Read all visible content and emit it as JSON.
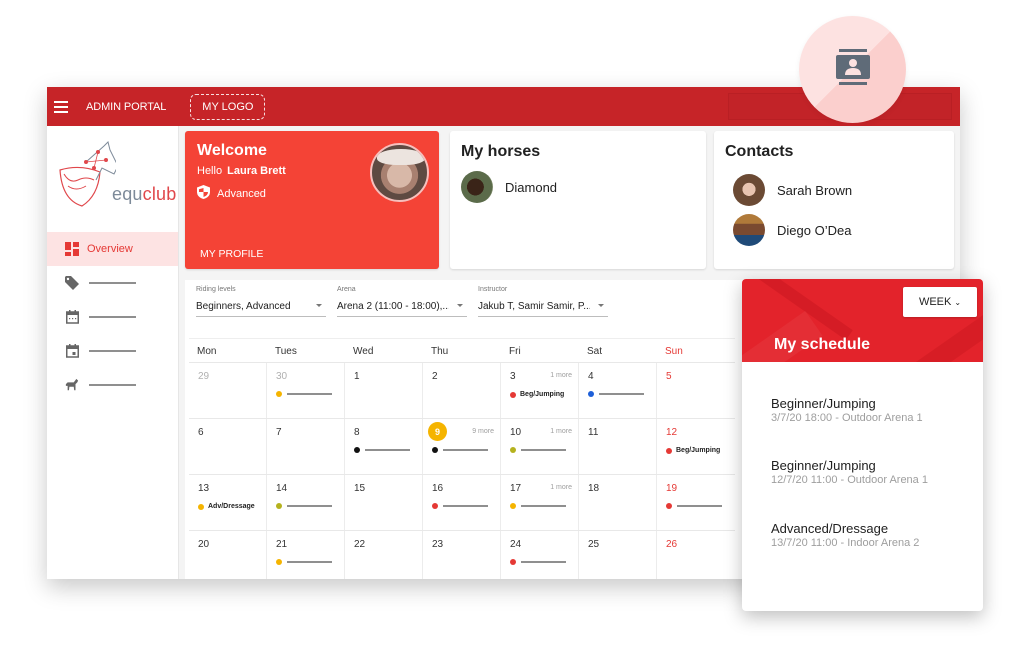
{
  "topbar": {
    "menu_icon": "hamburger-icon",
    "title": "ADMIN PORTAL",
    "logo_placeholder": "MY LOGO"
  },
  "floating_button": {
    "icon": "contact-card-icon"
  },
  "sidebar": {
    "brand": {
      "part1": "equ",
      "part2": "club"
    },
    "items": [
      {
        "icon": "dashboard-icon",
        "label": "Overview",
        "active": true
      },
      {
        "icon": "tag-icon",
        "label": ""
      },
      {
        "icon": "calendar-icon",
        "label": ""
      },
      {
        "icon": "calendar-event-icon",
        "label": ""
      },
      {
        "icon": "horse-icon",
        "label": ""
      }
    ]
  },
  "welcome": {
    "title": "Welcome",
    "hello": "Hello",
    "name": "Laura Brett",
    "level": "Advanced",
    "profile_link": "MY PROFILE"
  },
  "horses": {
    "title": "My horses",
    "items": [
      {
        "name": "Diamond"
      }
    ]
  },
  "contacts": {
    "title": "Contacts",
    "items": [
      {
        "name": "Sarah Brown"
      },
      {
        "name": "Diego O’Dea"
      }
    ]
  },
  "filters": [
    {
      "label": "Riding levels",
      "value": "Beginners, Advanced"
    },
    {
      "label": "Arena",
      "value": "Arena 2 (11:00 - 18:00),..."
    },
    {
      "label": "Instructor",
      "value": "Jakub T, Samir Samir, P..."
    }
  ],
  "calendar": {
    "weekdays": [
      "Mon",
      "Tues",
      "Wed",
      "Thu",
      "Fri",
      "Sat",
      "Sun"
    ],
    "weeks": [
      [
        {
          "day": "29",
          "muted": true
        },
        {
          "day": "30",
          "muted": true,
          "event": {
            "color": "#f5b400"
          }
        },
        {
          "day": "1"
        },
        {
          "day": "2"
        },
        {
          "day": "3",
          "more": "1 more",
          "event": {
            "color": "#e53935",
            "label": "Beg/Jumping"
          }
        },
        {
          "day": "4",
          "event": {
            "color": "#1e5fd8"
          }
        },
        {
          "day": "5",
          "sunday": true
        }
      ],
      [
        {
          "day": "6"
        },
        {
          "day": "7"
        },
        {
          "day": "8",
          "event": {
            "color": "#111111"
          }
        },
        {
          "day": "9",
          "today": true,
          "more": "9 more",
          "event": {
            "color": "#111111"
          }
        },
        {
          "day": "10",
          "more": "1 more",
          "event": {
            "color": "#b5b21e"
          }
        },
        {
          "day": "11"
        },
        {
          "day": "12",
          "sunday": true,
          "event": {
            "color": "#e53935",
            "label": "Beg/Jumping"
          }
        }
      ],
      [
        {
          "day": "13",
          "event": {
            "color": "#f5b400",
            "label": "Adv/Dressage"
          }
        },
        {
          "day": "14",
          "event": {
            "color": "#b5b21e"
          }
        },
        {
          "day": "15"
        },
        {
          "day": "16",
          "event": {
            "color": "#e53935"
          }
        },
        {
          "day": "17",
          "more": "1 more",
          "event": {
            "color": "#f5b400"
          }
        },
        {
          "day": "18"
        },
        {
          "day": "19",
          "sunday": true,
          "event": {
            "color": "#e53935"
          }
        }
      ],
      [
        {
          "day": "20"
        },
        {
          "day": "21",
          "event": {
            "color": "#f5b400"
          }
        },
        {
          "day": "22"
        },
        {
          "day": "23"
        },
        {
          "day": "24",
          "event": {
            "color": "#e53935"
          }
        },
        {
          "day": "25"
        },
        {
          "day": "26",
          "sunday": true
        }
      ]
    ]
  },
  "schedule": {
    "title": "My schedule",
    "view_button": "WEEK",
    "items": [
      {
        "name": "Beginner/Jumping",
        "detail": "3/7/20 18:00 - Outdoor Arena 1"
      },
      {
        "name": "Beginner/Jumping",
        "detail": "12/7/20 11:00 - Outdoor Arena 1"
      },
      {
        "name": "Advanced/Dressage",
        "detail": "13/7/20 11:00 - Indoor Arena 2"
      }
    ]
  },
  "colors": {
    "topbar": "#c62428",
    "accent": "#f44336",
    "today": "#f5b400",
    "sunday": "#e53935"
  }
}
